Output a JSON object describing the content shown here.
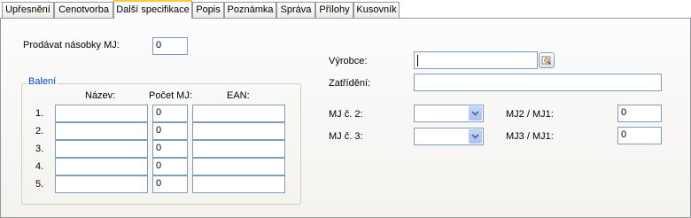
{
  "tabs": [
    "Upřesnění",
    "Cenotvorba",
    "Další specifikace",
    "Popis",
    "Poznámka",
    "Správa",
    "Přílohy",
    "Kusovník"
  ],
  "active_tab_index": 2,
  "left": {
    "multiple_label": "Prodávat násobky MJ:",
    "multiple_value": "0",
    "packaging": {
      "legend": "Balení",
      "col_name": "Název:",
      "col_qty": "Počet MJ:",
      "col_ean": "EAN:",
      "rows": [
        {
          "num": "1.",
          "name": "",
          "qty": "0",
          "ean": ""
        },
        {
          "num": "2.",
          "name": "",
          "qty": "0",
          "ean": ""
        },
        {
          "num": "3.",
          "name": "",
          "qty": "0",
          "ean": ""
        },
        {
          "num": "4.",
          "name": "",
          "qty": "0",
          "ean": ""
        },
        {
          "num": "5.",
          "name": "",
          "qty": "0",
          "ean": ""
        }
      ]
    }
  },
  "right": {
    "manufacturer_label": "Výrobce:",
    "manufacturer_value": "",
    "classification_label": "Zatřídění:",
    "classification_value": "",
    "mj2_label": "MJ č. 2:",
    "mj2_value": "",
    "mj3_label": "MJ č. 3:",
    "mj3_value": "",
    "ratio2_label": "MJ2 / MJ1:",
    "ratio2_value": "0",
    "ratio3_label": "MJ3 / MJ1:",
    "ratio3_value": "0"
  },
  "colors": {
    "accent_tab": "#ffc83c",
    "legend": "#0046d5",
    "input_border": "#7f9db9"
  },
  "icons": {
    "lookup": "lookup-icon",
    "dropdown": "chevron-down-icon"
  }
}
